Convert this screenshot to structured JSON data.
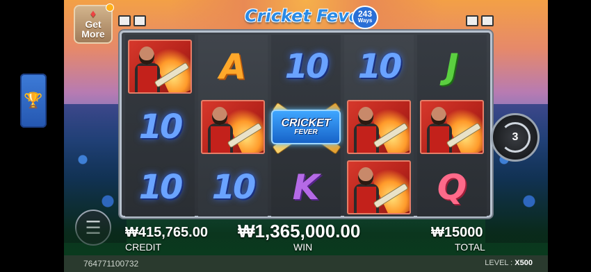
{
  "game": {
    "logo_text": "Cricket Fever",
    "ways_number": "243",
    "ways_label": "Ways"
  },
  "side_buttons": {
    "get_more_line1": "Get",
    "get_more_line2": "More"
  },
  "reels": [
    [
      "player",
      "10",
      "10"
    ],
    [
      "A",
      "player",
      "10"
    ],
    [
      "10",
      "wild",
      "K"
    ],
    [
      "10",
      "player",
      "player"
    ],
    [
      "J",
      "player",
      "Q"
    ]
  ],
  "wild_symbol": {
    "title": "CRICKET",
    "subtitle": "FEVER"
  },
  "spin": {
    "auto_count": "3"
  },
  "stats": {
    "credit_value": "₩415,765.00",
    "credit_label": "CREDIT",
    "win_value": "₩1,365,000.00",
    "win_label": "WIN",
    "total_value": "₩15000",
    "total_label": "TOTAL"
  },
  "footer": {
    "round_id": "764771100732",
    "level_label": "LEVEL :",
    "level_value": "X500"
  },
  "colors": {
    "ten": "#6aa3ff",
    "ace": "#ffa82a",
    "jack": "#5bd040",
    "king": "#b56ae6",
    "queen": "#ff6a8a",
    "player_card": "#c3211b"
  }
}
